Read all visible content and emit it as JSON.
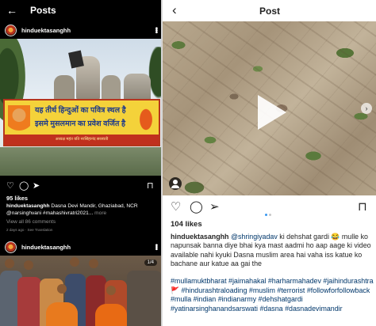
{
  "left": {
    "header": {
      "back": "←",
      "title": "Posts"
    },
    "post1": {
      "username": "hinduektasanghh",
      "banner_line1": "यह तीर्थ हिन्दुओं का पवित्र स्थल है",
      "banner_line2": "इसमे मुसलमान का प्रवेश वर्जित है",
      "banner_footer": "अध्यक्ष महंत यति नरसिंहानंद सरस्वती",
      "likes": "95 likes",
      "caption_user": "hinduektasanghh",
      "caption_text": " Dasna Devi Mandir, Ghaziabad, NCR @narsinghvani #mahashivratri2021...",
      "caption_more": " more",
      "view_comments": "View all 86 comments",
      "timestamp": "2 days ago · See Translation"
    },
    "post2": {
      "username": "hinduektasanghh",
      "badge": "1/4"
    }
  },
  "right": {
    "header": {
      "back": "‹",
      "title": "Post"
    },
    "likes": "104 likes",
    "caption_user": "hinduektasanghh",
    "caption_mention": "@shringiyadav",
    "caption_text": " ki dehshat gardi 😂 mulle ko napunsak banna diye bhai kya mast aadmi ho aap aage ki video available nahi kyuki Dasna muslim area hai vaha iss katue ko bachane aur katue aa gai the",
    "hashtags": "#mullamuktbharat #jaimahakal #harharmahadev #jaihindurashtra🚩 #hindurashtraloading #muslim #terrorist #followforfollowback #mulla #indian #indianarmy #dehshatgardi #yatinarsinghanandsarswati #dasna #dasnadevimandir"
  },
  "icons": {
    "like": "heart-icon",
    "comment": "comment-icon",
    "share": "share-icon",
    "save": "bookmark-icon",
    "more": "more-dots-icon",
    "play": "play-icon",
    "user_tag": "user-tag-icon"
  },
  "colors": {
    "link": "#00376b",
    "pager_active": "#3897f0",
    "dark_bg": "#000000",
    "light_bg": "#ffffff"
  }
}
